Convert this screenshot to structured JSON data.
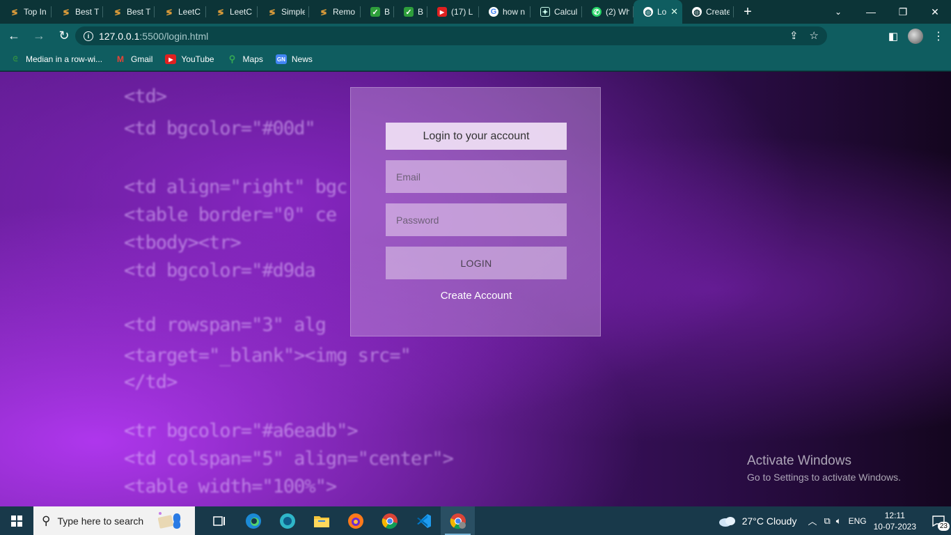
{
  "browser": {
    "tabs": [
      {
        "label": "Top In",
        "icon": "codingninjas-icon"
      },
      {
        "label": "Best T",
        "icon": "codingninjas-icon"
      },
      {
        "label": "Best T",
        "icon": "codingninjas-icon"
      },
      {
        "label": "LeetC",
        "icon": "codingninjas-icon"
      },
      {
        "label": "LeetC",
        "icon": "codingninjas-icon"
      },
      {
        "label": "Simple",
        "icon": "codingninjas-icon"
      },
      {
        "label": "Remo",
        "icon": "codingninjas-icon"
      },
      {
        "label": "Be",
        "icon": "checkbox-icon"
      },
      {
        "label": "Be",
        "icon": "checkbox-icon"
      },
      {
        "label": "(17) L",
        "icon": "youtube-icon"
      },
      {
        "label": "how n",
        "icon": "google-icon"
      },
      {
        "label": "Calcul",
        "icon": "chatgpt-icon"
      },
      {
        "label": "(2) Wh",
        "icon": "whatsapp-icon"
      },
      {
        "label": "Lo",
        "icon": "globe-icon",
        "active": true
      },
      {
        "label": "Create",
        "icon": "globe-icon"
      }
    ],
    "new_tab": "+",
    "url_host": "127.0.0.1",
    "url_path": ":5500/login.html",
    "bookmarks": [
      {
        "label": "Median in a row-wi...",
        "icon": "gfg-icon"
      },
      {
        "label": "Gmail",
        "icon": "gmail-icon"
      },
      {
        "label": "YouTube",
        "icon": "youtube-icon"
      },
      {
        "label": "Maps",
        "icon": "maps-icon"
      },
      {
        "label": "News",
        "icon": "news-icon"
      }
    ]
  },
  "login": {
    "title": "Login to your account",
    "email_placeholder": "Email",
    "password_placeholder": "Password",
    "login_button": "LOGIN",
    "create_account": "Create Account"
  },
  "background_code": [
    "<td>",
    "<td bgcolor=\"#00d\"",
    "<td align=\"right\" bgc",
    "<table border=\"0\" ce",
    "<tbody><tr>",
    "<td bgcolor=\"#d9da",
    "<td rowspan=\"3\" alg",
    "<target=\"_blank\"><img src=\"",
    "</td>",
    "<tr bgcolor=\"#a6eadb\">",
    "<td colspan=\"5\" align=\"center\">",
    "<table width=\"100%\">"
  ],
  "watermark": {
    "heading": "Activate Windows",
    "sub": "Go to Settings to activate Windows."
  },
  "taskbar": {
    "search_placeholder": "Type here to search",
    "weather": "27°C  Cloudy",
    "language": "ENG",
    "time": "12:11",
    "date": "10-07-2023",
    "notifications": "23",
    "apps": [
      "task-view-icon",
      "edge-icon",
      "edge-beta-icon",
      "file-explorer-icon",
      "firefox-icon",
      "chrome-icon",
      "vscode-icon",
      "chrome-profile-icon"
    ]
  },
  "colors": {
    "browser_frame": "#0f5d60",
    "tab_strip": "#0c3437",
    "taskbar": "#18394a"
  }
}
